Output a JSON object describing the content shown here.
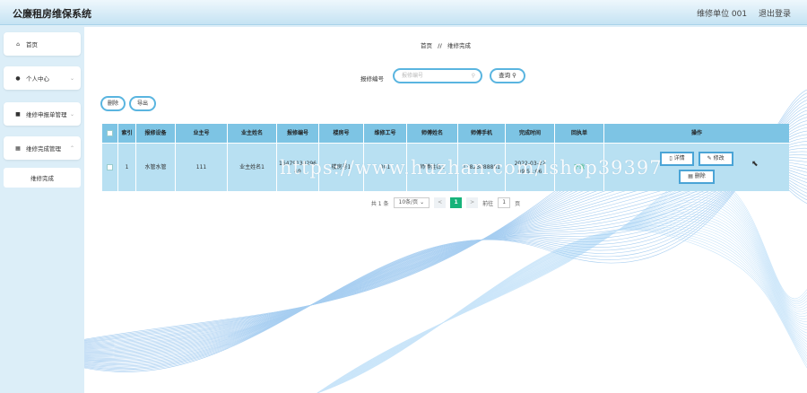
{
  "app": {
    "title": "公廉租房维保系统"
  },
  "header": {
    "user_role": "维修单位 001",
    "logout": "退出登录"
  },
  "sidebar": {
    "items": [
      {
        "label": "首页",
        "icon": "home-icon",
        "glyph": "⌂",
        "expandable": false
      },
      {
        "label": "个人中心",
        "icon": "user-icon",
        "glyph": "●",
        "expandable": true
      },
      {
        "label": "维修申报单管理",
        "icon": "list-icon",
        "glyph": "■",
        "expandable": true
      },
      {
        "label": "维修完成管理",
        "icon": "grid-icon",
        "glyph": "▦",
        "expandable": true
      }
    ],
    "sub_item": "维修完成"
  },
  "breadcrumb": {
    "home": "首页",
    "separator": "//",
    "current": "维修完成"
  },
  "search": {
    "label": "报修编号",
    "placeholder": "报修编号",
    "button": "查询"
  },
  "actions": {
    "delete": "删除",
    "export": "导出"
  },
  "table": {
    "headers": [
      "",
      "索引",
      "报修设备",
      "业主号",
      "业主姓名",
      "报修编号",
      "楼房号",
      "维修工号",
      "师傅姓名",
      "师傅手机",
      "完成时间",
      "回执单",
      "操作"
    ],
    "rows": [
      {
        "index": "1",
        "device": "水管水管",
        "owner_no": "111",
        "owner_name": "业主姓名1",
        "repair_no": "1647913829649",
        "building": "楼房号1",
        "worker_no": "001",
        "master_name": "师傅姓名1",
        "master_phone": "13823888881",
        "finish_time": "2022-03-22 09:51:06",
        "receipt": "下载"
      }
    ],
    "row_actions": {
      "detail": "详情",
      "edit": "修改",
      "delete": "删除"
    }
  },
  "pager": {
    "total": "共 1 条",
    "page_size": "10条/页",
    "prev": "<",
    "current": "1",
    "next": ">",
    "goto_label": "前往",
    "goto_value": "1",
    "page_unit": "页"
  },
  "watermark": "https://www.huzhan.com/ishop39397",
  "colors": {
    "accent": "#5ab5e0",
    "table_header": "#7dc4e4",
    "table_row": "#b8e0f2",
    "page_active": "#17b37a"
  }
}
